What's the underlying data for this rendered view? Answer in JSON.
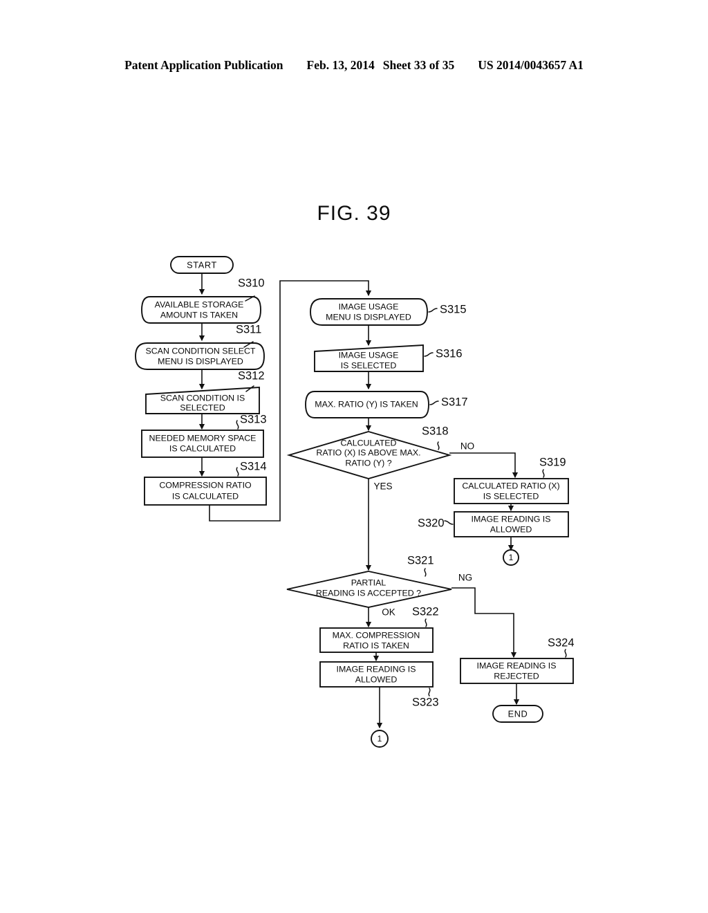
{
  "page": {
    "background": "#ffffff",
    "ink": "#111111"
  },
  "header": {
    "publication": "Patent Application Publication",
    "date": "Feb. 13, 2014",
    "sheet": "Sheet 33 of 35",
    "number": "US 2014/0043657 A1"
  },
  "figure": {
    "caption": "FIG. 39",
    "type": "flowchart"
  },
  "flowchart": {
    "terminators": {
      "start": "START",
      "end": "END"
    },
    "connectors": {
      "circle_a": "1",
      "circle_b": "1"
    },
    "branch_labels": {
      "s318_no": "NO",
      "s318_yes": "YES",
      "s321_ng": "NG",
      "s321_ok": "OK"
    },
    "nodes": [
      {
        "id": "S310",
        "label": "S310",
        "shape": "stored-data",
        "lines": [
          "AVAILABLE STORAGE",
          "AMOUNT IS TAKEN"
        ]
      },
      {
        "id": "S311",
        "label": "S311",
        "shape": "display",
        "lines": [
          "SCAN CONDITION SELECT",
          "MENU IS DISPLAYED"
        ]
      },
      {
        "id": "S312",
        "label": "S312",
        "shape": "manual-input",
        "lines": [
          "SCAN CONDITION IS",
          "SELECTED"
        ]
      },
      {
        "id": "S313",
        "label": "S313",
        "shape": "process",
        "lines": [
          "NEEDED MEMORY SPACE",
          "IS CALCULATED"
        ]
      },
      {
        "id": "S314",
        "label": "S314",
        "shape": "process",
        "lines": [
          "COMPRESSION RATIO",
          "IS CALCULATED"
        ]
      },
      {
        "id": "S315",
        "label": "S315",
        "shape": "display",
        "lines": [
          "IMAGE USAGE",
          "MENU IS DISPLAYED"
        ]
      },
      {
        "id": "S316",
        "label": "S316",
        "shape": "manual-input",
        "lines": [
          "IMAGE USAGE",
          "IS SELECTED"
        ]
      },
      {
        "id": "S317",
        "label": "S317",
        "shape": "stored-data",
        "lines": [
          "MAX. RATIO (Y) IS TAKEN"
        ]
      },
      {
        "id": "S318",
        "label": "S318",
        "shape": "decision",
        "lines": [
          "CALCULATED",
          "RATIO (X) IS ABOVE MAX.",
          "RATIO (Y) ?"
        ]
      },
      {
        "id": "S319",
        "label": "S319",
        "shape": "process",
        "lines": [
          "CALCULATED RATIO (X)",
          "IS SELECTED"
        ]
      },
      {
        "id": "S320",
        "label": "S320",
        "shape": "process",
        "lines": [
          "IMAGE READING IS",
          "ALLOWED"
        ]
      },
      {
        "id": "S321",
        "label": "S321",
        "shape": "decision",
        "lines": [
          "PARTIAL",
          "READING IS ACCEPTED ?"
        ]
      },
      {
        "id": "S322",
        "label": "S322",
        "shape": "process",
        "lines": [
          "MAX. COMPRESSION",
          "RATIO IS TAKEN"
        ]
      },
      {
        "id": "S323",
        "label": "S323",
        "shape": "process",
        "lines": [
          "IMAGE READING IS",
          "ALLOWED"
        ]
      },
      {
        "id": "S324",
        "label": "S324",
        "shape": "process",
        "lines": [
          "IMAGE READING IS",
          "REJECTED"
        ]
      }
    ]
  }
}
